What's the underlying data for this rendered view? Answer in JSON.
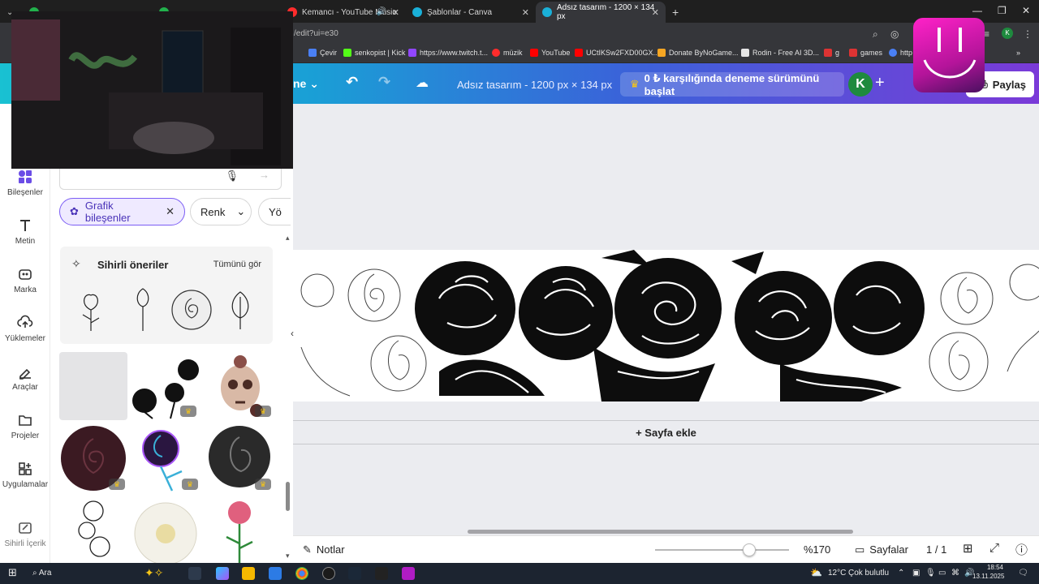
{
  "browser": {
    "tabs": [
      {
        "title": "",
        "color": "#22b14c"
      },
      {
        "title": "",
        "color": "#22b14c"
      },
      {
        "title": "Kemancı - YouTube Music",
        "color": "#ff2c2c"
      },
      {
        "title": "Şablonlar - Canva",
        "color": "#1ab0d8"
      },
      {
        "title": "Adsız tasarım - 1200 × 134 px",
        "color": "#1ab0d8"
      }
    ],
    "new_tab": "+",
    "url": "/edit?ui=e30",
    "profile_letter": "K",
    "bookmarks": [
      {
        "label": "Çevir",
        "color": "#4a80f5"
      },
      {
        "label": "senkopist | Kick",
        "color": "#53fc18"
      },
      {
        "label": "https://www.twitch.t...",
        "color": "#9146ff"
      },
      {
        "label": "müzik",
        "color": "#ff2c2c"
      },
      {
        "label": "YouTube",
        "color": "#ff0000"
      },
      {
        "label": "UCtIKSw2FXD00GX...",
        "color": "#ff0000"
      },
      {
        "label": "Donate ByNoGame...",
        "color": "#f6a623"
      },
      {
        "label": "Rodin - Free AI 3D...",
        "color": "#e6e6e6"
      },
      {
        "label": "g",
        "color": "#d33"
      },
      {
        "label": "games",
        "color": "#d33"
      },
      {
        "label": "http",
        "color": "#4a80f5"
      }
    ]
  },
  "header": {
    "menu_label": "ne",
    "design_title": "Adsız tasarım - 1200 px × 134 px",
    "trial_button": "0 ₺ karşılığında deneme sürümünü başlat",
    "avatar_letter": "K",
    "share_button": "Paylaş"
  },
  "rail": [
    {
      "label": "Bileşenler",
      "icon": "elements-icon"
    },
    {
      "label": "Metin",
      "icon": "text-icon"
    },
    {
      "label": "Marka",
      "icon": "brand-icon"
    },
    {
      "label": "Yüklemeler",
      "icon": "upload-icon"
    },
    {
      "label": "Araçlar",
      "icon": "tools-icon"
    },
    {
      "label": "Projeler",
      "icon": "folder-icon"
    },
    {
      "label": "Uygulamalar",
      "icon": "apps-icon"
    },
    {
      "label": "Sihirli İçerik",
      "icon": "magic-media-icon"
    }
  ],
  "panel": {
    "chips": [
      "Grafik bileşenler",
      "Renk",
      "Yö"
    ],
    "magic_title": "Sihirli öneriler",
    "magic_all": "Tümünü gör"
  },
  "canvas": {
    "add_page": "+ Sayfa ekle"
  },
  "bottom": {
    "notes": "Notlar",
    "zoom_value": 0.7,
    "zoom": "%170",
    "pages": "Sayfalar",
    "page_counter": "1 / 1"
  },
  "taskbar": {
    "search": "Ara",
    "weather_temp": "12°C",
    "weather_text": "Çok bulutlu",
    "time": "18:54",
    "date": "13.11.2025"
  }
}
